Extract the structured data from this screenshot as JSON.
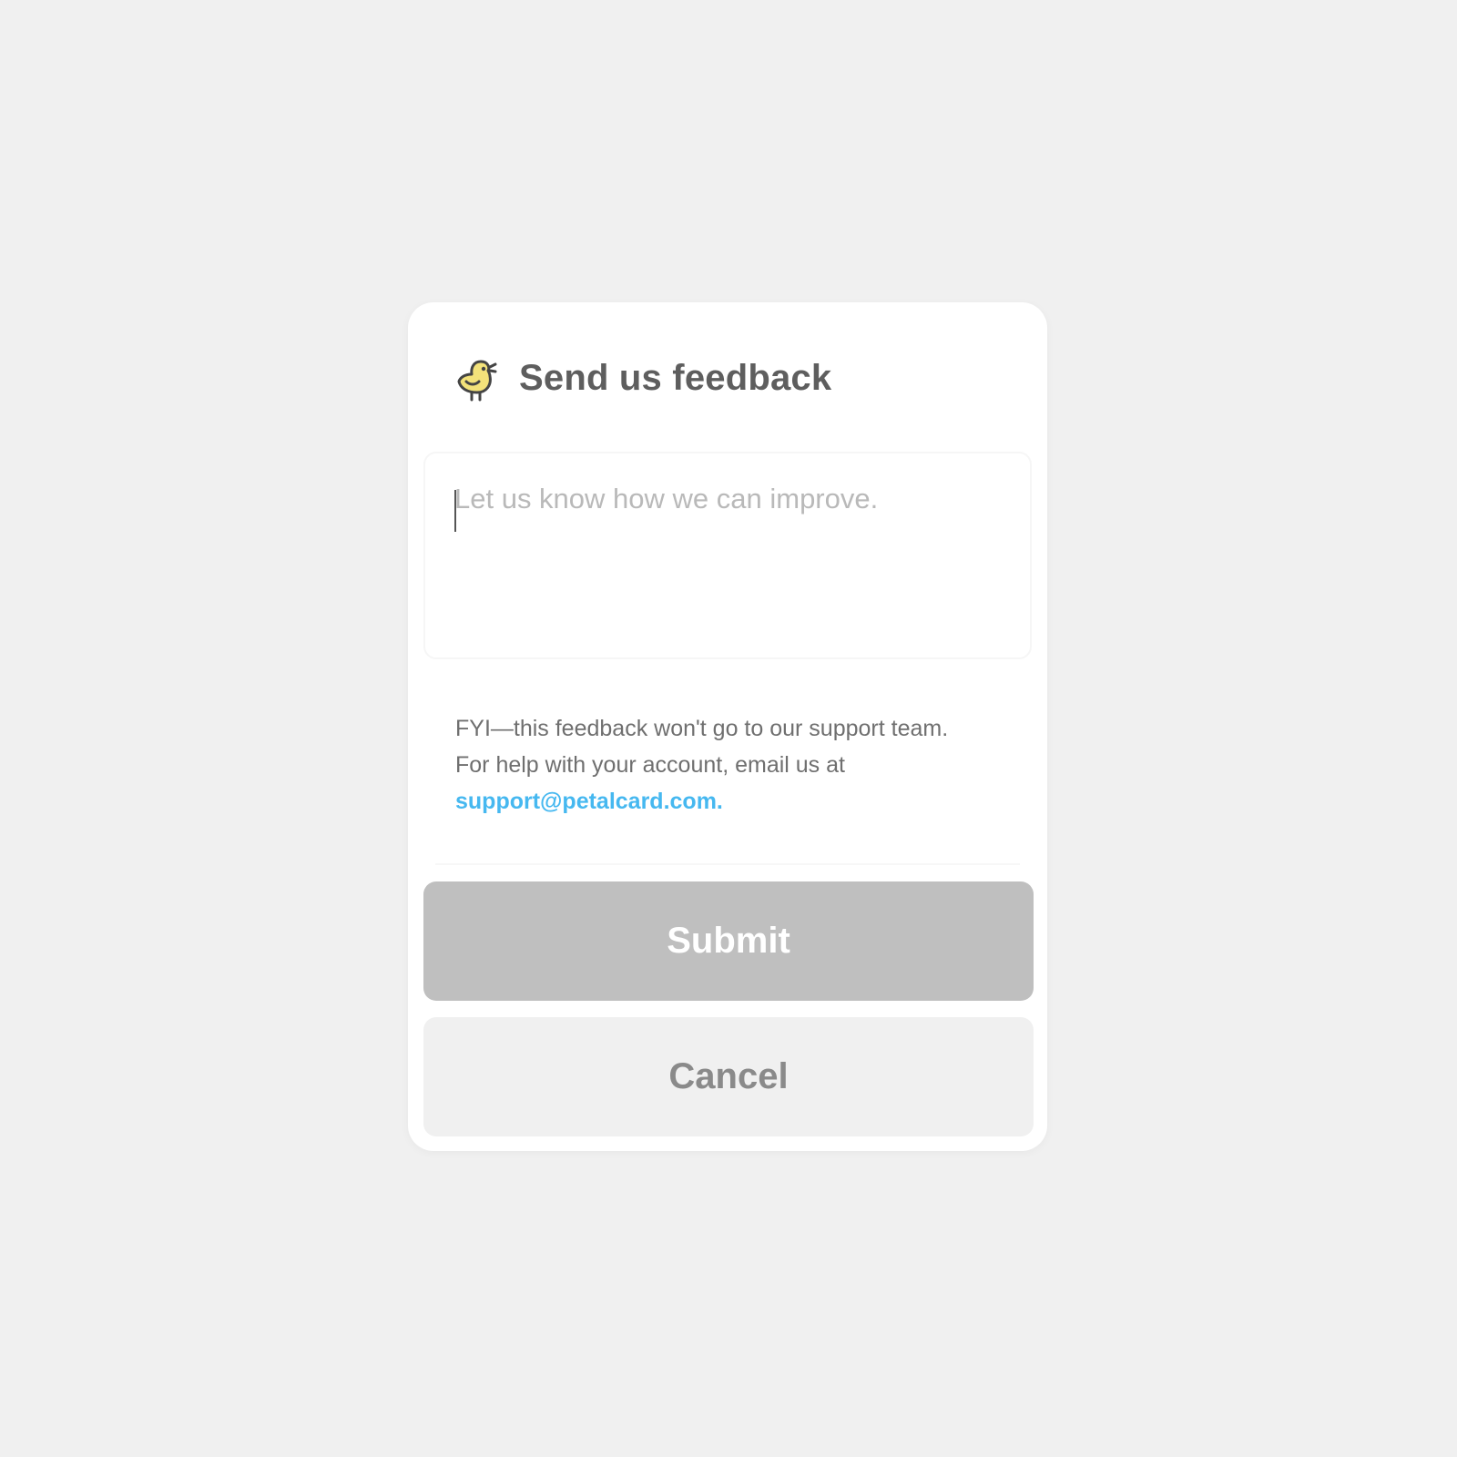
{
  "modal": {
    "title": "Send us feedback",
    "icon": "bird-icon"
  },
  "feedback": {
    "placeholder": "Let us know how we can improve.",
    "value": ""
  },
  "info": {
    "line1": "FYI—this feedback won't go to our support team.",
    "line2": "For help with your account, email us at",
    "email": "support@petalcard.com."
  },
  "buttons": {
    "submit_label": "Submit",
    "cancel_label": "Cancel"
  },
  "colors": {
    "background": "#f0f0f0",
    "card": "#ffffff",
    "title": "#5e5e5e",
    "link": "#46b8f0",
    "submit_disabled": "#bfbfbf",
    "cancel_bg": "#f0f0f0",
    "bird_yellow": "#f3e27a"
  }
}
